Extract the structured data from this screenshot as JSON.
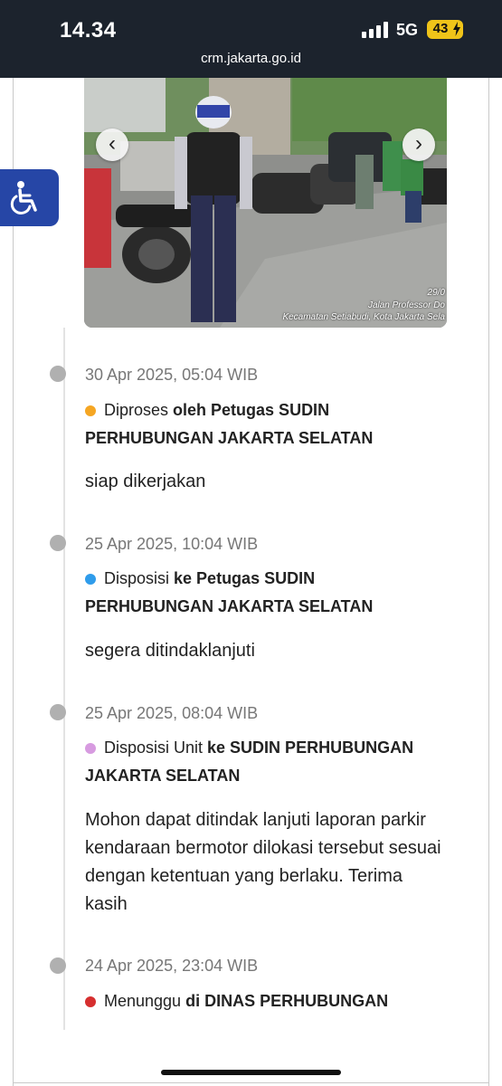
{
  "status_bar": {
    "time": "14.34",
    "network": "5G",
    "battery": "43"
  },
  "url_bar": {
    "url": "crm.jakarta.go.id"
  },
  "accessibility": {
    "icon": "wheelchair-icon"
  },
  "photo": {
    "nav_prev": "‹",
    "nav_next": "›",
    "stamp_date": "29/0",
    "stamp_street": "Jalan Professor Do",
    "stamp_area": "Kecamatan Setiabudi, Kota Jakarta Sela"
  },
  "timeline": [
    {
      "time": "30 Apr 2025, 05:04 WIB",
      "status_color": "#f5a623",
      "status_prefix": "Diproses ",
      "status_bold": "oleh Petugas SUDIN PERHUBUNGAN JAKARTA SELATAN",
      "note": "siap dikerjakan"
    },
    {
      "time": "25 Apr 2025, 10:04 WIB",
      "status_color": "#2f9ceb",
      "status_prefix": "Disposisi ",
      "status_bold": "ke Petugas SUDIN PERHUBUNGAN JAKARTA SELATAN",
      "note": "segera ditindaklanjuti"
    },
    {
      "time": "25 Apr 2025, 08:04 WIB",
      "status_color": "#d79be0",
      "status_prefix": "Disposisi Unit ",
      "status_bold": "ke SUDIN PERHUBUNGAN JAKARTA SELATAN",
      "note": "Mohon dapat ditindak lanjuti laporan parkir kendaraan bermotor dilokasi tersebut sesuai dengan ketentuan yang berlaku. Terima kasih"
    },
    {
      "time": "24 Apr 2025, 23:04 WIB",
      "status_color": "#d62f2f",
      "status_prefix": "Menunggu ",
      "status_bold": "di DINAS PERHUBUNGAN",
      "note": ""
    }
  ]
}
